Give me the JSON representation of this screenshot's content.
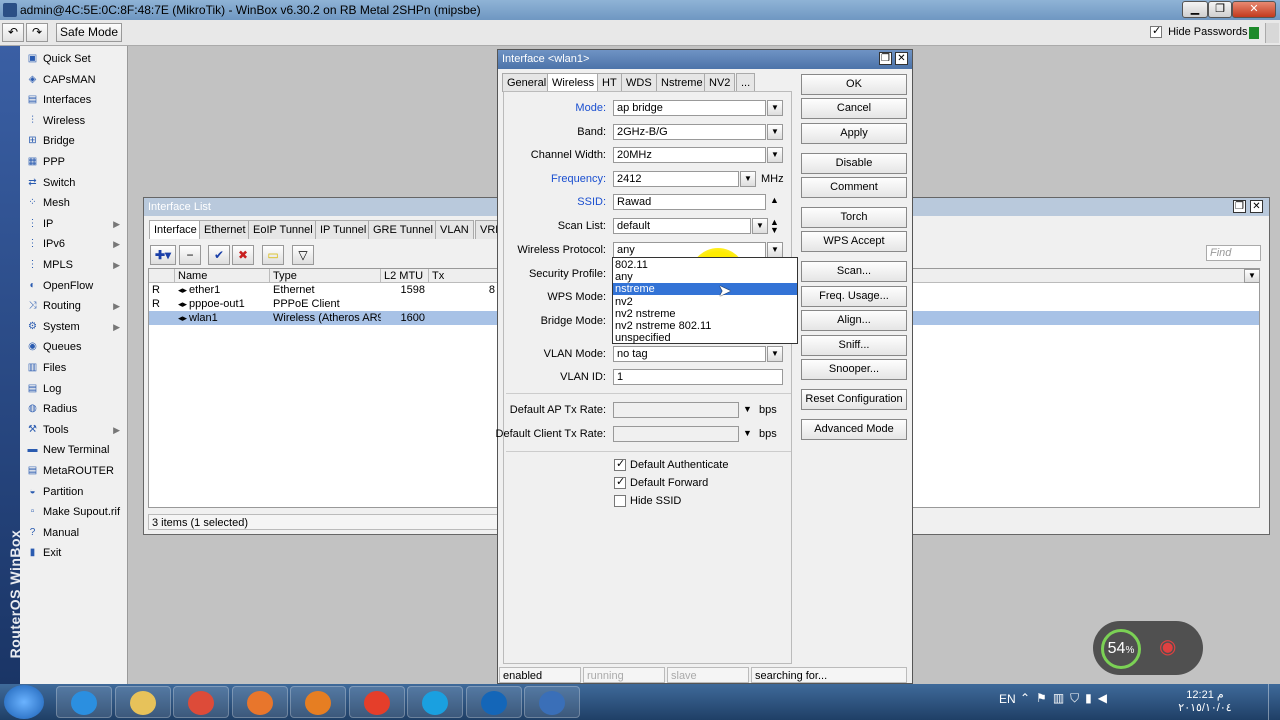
{
  "title_bar": {
    "title": "admin@4C:5E:0C:8F:48:7E (MikroTik) - WinBox v6.30.2 on RB Metal 2SHPn (mipsbe)"
  },
  "toolbar": {
    "undo_icon": "undo-icon",
    "redo_icon": "redo-icon",
    "safe_mode": "Safe Mode",
    "hide_passwords": "Hide Passwords",
    "hide_passwords_checked": true
  },
  "sidebar": {
    "brand": "RouterOS WinBox",
    "items": [
      {
        "label": "Quick Set",
        "icon": "quickset-icon"
      },
      {
        "label": "CAPsMAN",
        "icon": "capsman-icon"
      },
      {
        "label": "Interfaces",
        "icon": "interfaces-icon"
      },
      {
        "label": "Wireless",
        "icon": "wireless-icon"
      },
      {
        "label": "Bridge",
        "icon": "bridge-icon"
      },
      {
        "label": "PPP",
        "icon": "ppp-icon"
      },
      {
        "label": "Switch",
        "icon": "switch-icon"
      },
      {
        "label": "Mesh",
        "icon": "mesh-icon"
      },
      {
        "label": "IP",
        "icon": "ip-icon",
        "submenu": true
      },
      {
        "label": "IPv6",
        "icon": "ipv6-icon",
        "submenu": true
      },
      {
        "label": "MPLS",
        "icon": "mpls-icon",
        "submenu": true
      },
      {
        "label": "OpenFlow",
        "icon": "openflow-icon"
      },
      {
        "label": "Routing",
        "icon": "routing-icon",
        "submenu": true
      },
      {
        "label": "System",
        "icon": "system-icon",
        "submenu": true
      },
      {
        "label": "Queues",
        "icon": "queues-icon"
      },
      {
        "label": "Files",
        "icon": "files-icon"
      },
      {
        "label": "Log",
        "icon": "log-icon"
      },
      {
        "label": "Radius",
        "icon": "radius-icon"
      },
      {
        "label": "Tools",
        "icon": "tools-icon",
        "submenu": true
      },
      {
        "label": "New Terminal",
        "icon": "terminal-icon"
      },
      {
        "label": "MetaROUTER",
        "icon": "metarouter-icon"
      },
      {
        "label": "Partition",
        "icon": "partition-icon"
      },
      {
        "label": "Make Supout.rif",
        "icon": "supout-icon"
      },
      {
        "label": "Manual",
        "icon": "manual-icon"
      },
      {
        "label": "Exit",
        "icon": "exit-icon"
      }
    ]
  },
  "interface_list": {
    "title": "Interface List",
    "tabs": [
      "Interface",
      "Ethernet",
      "EoIP Tunnel",
      "IP Tunnel",
      "GRE Tunnel",
      "VLAN",
      "VRR"
    ],
    "active_tab": "Interface",
    "find_placeholder": "Find",
    "columns": [
      "Name",
      "Type",
      "L2 MTU",
      "Tx"
    ],
    "rows": [
      {
        "flag": "R",
        "name": "ether1",
        "type": "Ethernet",
        "l2mtu": "1598",
        "tx": "8",
        "selected": false
      },
      {
        "flag": "R",
        "name": "pppoe-out1",
        "type": "PPPoE Client",
        "l2mtu": "",
        "tx": "",
        "selected": false
      },
      {
        "flag": "",
        "name": "wlan1",
        "type": "Wireless (Atheros AR9...",
        "l2mtu": "1600",
        "tx": "",
        "selected": true
      }
    ],
    "status": "3 items (1 selected)"
  },
  "wlan_dialog": {
    "title": "Interface <wlan1>",
    "tabs": [
      "General",
      "Wireless",
      "HT",
      "WDS",
      "Nstreme",
      "NV2",
      "..."
    ],
    "active_tab": "Wireless",
    "fields": {
      "mode": {
        "label": "Mode:",
        "value": "ap bridge"
      },
      "band": {
        "label": "Band:",
        "value": "2GHz-B/G"
      },
      "channel_width": {
        "label": "Channel Width:",
        "value": "20MHz"
      },
      "frequency": {
        "label": "Frequency:",
        "value": "2412",
        "unit": "MHz"
      },
      "ssid": {
        "label": "SSID:",
        "value": "Rawad"
      },
      "scan_list": {
        "label": "Scan List:",
        "value": "default"
      },
      "wireless_protocol": {
        "label": "Wireless Protocol:",
        "value": "any"
      },
      "security_profile": {
        "label": "Security Profile:"
      },
      "wps_mode": {
        "label": "WPS Mode:"
      },
      "bridge_mode": {
        "label": "Bridge Mode:"
      },
      "vlan_mode": {
        "label": "VLAN Mode:",
        "value": "no tag"
      },
      "vlan_id": {
        "label": "VLAN ID:",
        "value": "1"
      },
      "default_ap_tx_rate": {
        "label": "Default AP Tx Rate:",
        "value": "",
        "unit": "bps"
      },
      "default_client_tx_rate": {
        "label": "Default Client Tx Rate:",
        "value": "",
        "unit": "bps"
      }
    },
    "checkboxes": [
      {
        "label": "Default Authenticate",
        "checked": true
      },
      {
        "label": "Default Forward",
        "checked": true
      },
      {
        "label": "Hide SSID",
        "checked": false
      }
    ],
    "protocol_options": [
      "802.11",
      "any",
      "nstreme",
      "nv2",
      "nv2 nstreme",
      "nv2 nstreme 802.11",
      "unspecified"
    ],
    "protocol_highlighted": "nstreme",
    "buttons": [
      "OK",
      "Cancel",
      "Apply",
      "Disable",
      "Comment",
      "Torch",
      "WPS Accept",
      "Scan...",
      "Freq. Usage...",
      "Align...",
      "Sniff...",
      "Snooper...",
      "Reset Configuration",
      "Advanced Mode"
    ],
    "status": [
      "enabled",
      "running",
      "slave",
      "searching for..."
    ]
  },
  "net_widget": {
    "percent": "54",
    "unit": "%"
  },
  "taskbar": {
    "apps": [
      "start",
      "internet-explorer",
      "file-explorer",
      "chrome",
      "firefox",
      "media-player",
      "torch-browser",
      "skype",
      "teamviewer",
      "winbox"
    ],
    "lang": "EN",
    "time": "12:21 م",
    "date": "٢٠١٥/١٠/٠٤"
  },
  "colors": {
    "accent_blue": "#1a4fd0",
    "selection": "#a8c2e6",
    "highlight": "#3373d6",
    "cursor_highlight": "#fff000"
  }
}
